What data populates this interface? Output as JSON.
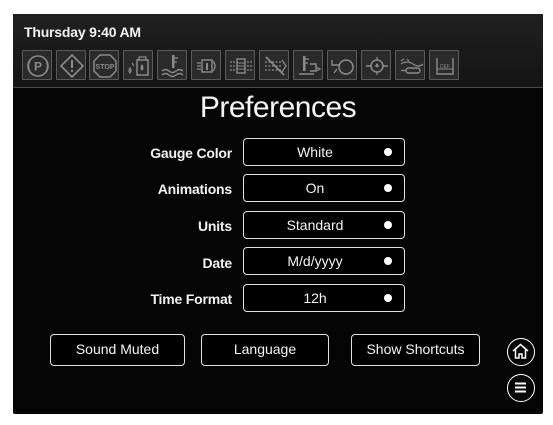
{
  "header": {
    "datetime": "Thursday 9:40 AM",
    "telltales": [
      "parking-brake-icon",
      "warning-icon",
      "stop-icon",
      "water-in-fuel-icon",
      "coolant-temp-icon",
      "engine-preheat-icon",
      "air-filter-icon",
      "regen-disabled-icon",
      "transmission-temp-icon",
      "oil-level-icon",
      "oil-pressure-icon",
      "glow-plug-icon",
      "def-level-icon"
    ],
    "telltale_labels": {
      "stop": "STOP",
      "def": "DEF"
    }
  },
  "page": {
    "title": "Preferences"
  },
  "settings": [
    {
      "label": "Gauge Color",
      "value": "White"
    },
    {
      "label": "Animations",
      "value": "On"
    },
    {
      "label": "Units",
      "value": "Standard"
    },
    {
      "label": "Date",
      "value": "M/d/yyyy"
    },
    {
      "label": "Time Format",
      "value": "12h"
    }
  ],
  "buttons": {
    "sound": "Sound Muted",
    "language": "Language",
    "shortcuts": "Show Shortcuts"
  },
  "colors": {
    "background": "#050505",
    "header": "#1a1a1a",
    "telltale_inactive": "#8a8a8a",
    "text": "#f4f4f4",
    "outline": "#e0e0e0"
  }
}
